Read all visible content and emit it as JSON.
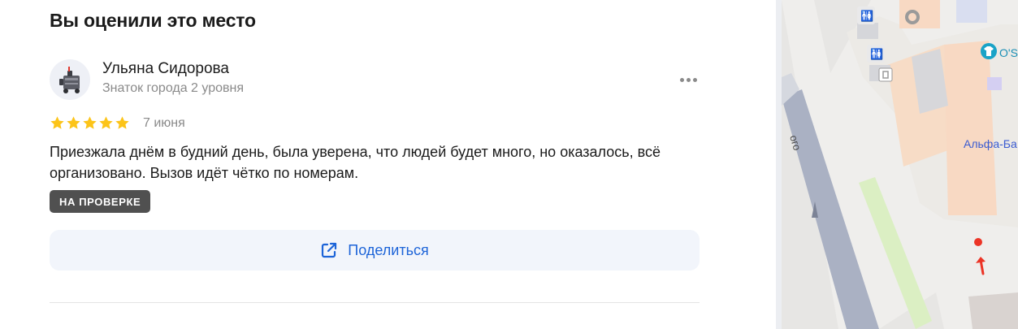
{
  "section": {
    "title": "Вы оценили это место"
  },
  "review": {
    "author": {
      "name": "Ульяна Сидорова",
      "level": "Знаток города 2 уровня"
    },
    "rating": 5,
    "date": "7 июня",
    "text": "Приезжала днём в будний день, была уверена, что людей будет много, но оказалось, всё организовано. Вызов идёт чётко по номерам.",
    "status": "НА ПРОВЕРКЕ"
  },
  "actions": {
    "share_label": "Поделиться"
  },
  "map": {
    "labels": {
      "bank": "Альфа-Ба",
      "shop": "O'S",
      "street": "ого"
    }
  },
  "colors": {
    "accent": "#1d64d8",
    "star": "#fcc419",
    "badge": "#505050",
    "map_location": "#ec3426"
  },
  "icons": [
    "more-icon",
    "star-icon",
    "share-icon",
    "robot-avatar-icon",
    "location-marker-icon",
    "direction-arrow-icon"
  ]
}
